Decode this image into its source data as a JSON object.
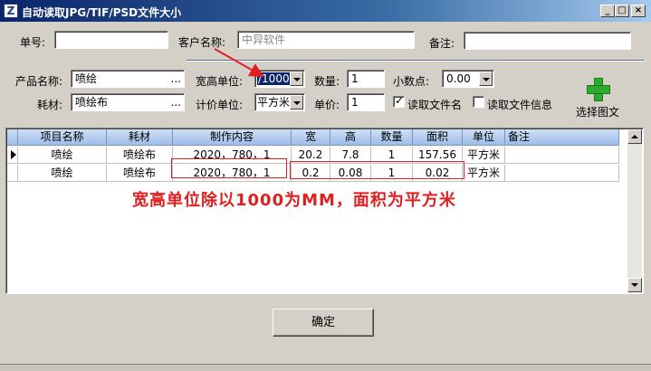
{
  "window": {
    "title": "自动读取JPG/TIF/PSD文件大小",
    "icon": "app-icon"
  },
  "header_row": {
    "order_no_label": "单号:",
    "order_no_value": "",
    "customer_label": "客户名称:",
    "customer_placeholder": "中异软件",
    "remark_label": "备注:",
    "remark_value": ""
  },
  "form": {
    "product_label": "产品名称:",
    "product_value": "喷绘",
    "material_label": "耗材:",
    "material_value": "喷绘布",
    "ellipsis": "...",
    "wh_unit_label": "宽高单位:",
    "wh_unit_value": "/1000",
    "quantity_label": "数量:",
    "quantity_value": "1",
    "decimals_label": "小数点:",
    "decimals_value": "0.00",
    "price_unit_label": "计价单位:",
    "price_unit_value": "平方米",
    "unit_price_label": "单价:",
    "unit_price_value": "1",
    "read_filename_label": "读取文件名",
    "read_filename_checked": true,
    "read_fileinfo_label": "读取文件信息",
    "read_fileinfo_checked": false,
    "select_image_label": "选择图文"
  },
  "grid": {
    "columns": [
      "项目名称",
      "耗材",
      "制作内容",
      "宽",
      "高",
      "数量",
      "面积",
      "单位",
      "备注"
    ],
    "rows": [
      [
        "喷绘",
        "喷绘布",
        "2020，780，1",
        "20.2",
        "7.8",
        "1",
        "157.56",
        "平方米",
        ""
      ],
      [
        "喷绘",
        "喷绘布",
        "2020，780，1",
        "0.2",
        "0.08",
        "1",
        "0.02",
        "平方米",
        ""
      ]
    ]
  },
  "annotation": "宽高单位除以1000为MM，面积为平方米",
  "ok_button": "确定",
  "colors": {
    "annotation_red": "#e02020",
    "title_blue": "#0a246a",
    "header_blue": "#9dbde8"
  }
}
